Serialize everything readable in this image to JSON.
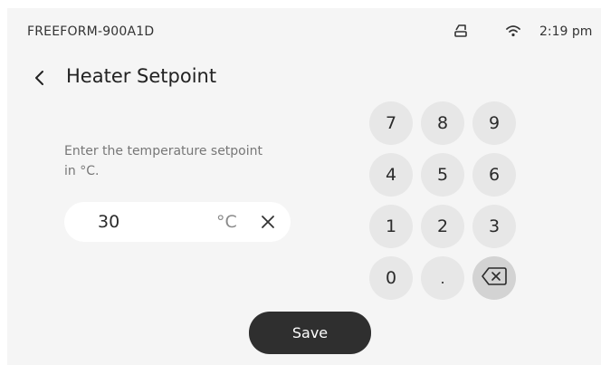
{
  "status_bar": {
    "device_name": "FREEFORM-900A1D",
    "time": "2:19 pm",
    "icons": [
      "sim-card-icon",
      "wifi-icon"
    ]
  },
  "header": {
    "back_icon": "chevron-left-icon",
    "title": "Heater Setpoint"
  },
  "form": {
    "instructions": "Enter the temperature setpoint in °C.",
    "value": "30",
    "unit": "°C",
    "clear_icon": "close-icon"
  },
  "keypad": {
    "keys": [
      "7",
      "8",
      "9",
      "4",
      "5",
      "6",
      "1",
      "2",
      "3",
      "0",
      "."
    ],
    "backspace_icon": "backspace-icon"
  },
  "actions": {
    "save_label": "Save"
  },
  "colors": {
    "screen_background": "#f5f5f5",
    "key_background": "#e7e7e7",
    "backspace_background": "#d3d3d3",
    "primary_button": "#2f2f2f",
    "text": "#2b2b2b",
    "muted_text": "#777777"
  }
}
